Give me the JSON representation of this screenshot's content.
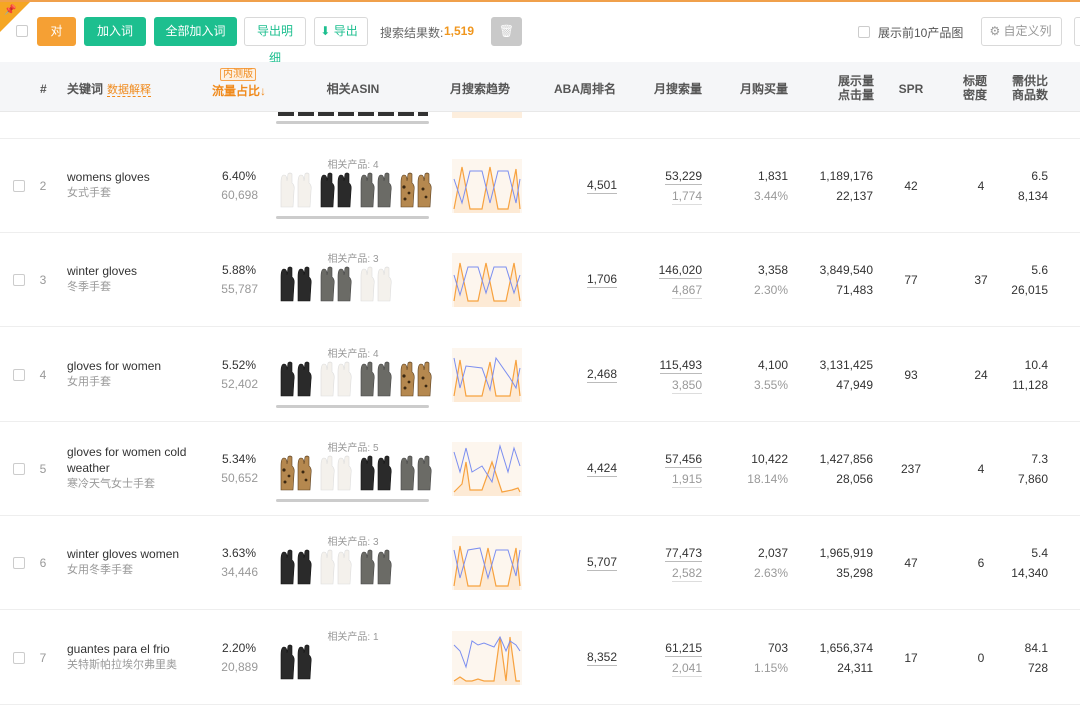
{
  "toolbar": {
    "compare": "对比",
    "add_to_lexicon": "加入词库",
    "add_all": "全部加入词库",
    "export_detail": "导出明细",
    "export": "导出",
    "result_label": "搜索结果数:",
    "result_count": "1,519",
    "show_top10": "展示前10产品图",
    "custom_columns": "自定义列"
  },
  "headers": {
    "index": "#",
    "keyword": "关键词",
    "data_explain": "数据解释",
    "beta": "内测版",
    "flow_share": "流量占比↓",
    "asin": "相关ASIN",
    "trend": "月搜索趋势",
    "aba": "ABA周排名",
    "monthly_search": "月搜索量",
    "monthly_buy": "月购买量",
    "impressions_1": "展示量",
    "impressions_2": "点击量",
    "spr": "SPR",
    "title_1": "标题",
    "title_2": "密度",
    "supply_1": "需供比",
    "supply_2": "商品数"
  },
  "colors": {
    "accent_orange": "#f5a034",
    "accent_green": "#1dbf8f",
    "trend_orange": "#f7a23f",
    "trend_blue": "#7b8ef0"
  },
  "rows": [
    {
      "idx": "2",
      "kw": "womens gloves",
      "kw_cn": "女式手套",
      "pct": "6.40%",
      "pct_n": "60,698",
      "prod_label": "相关产品: 4",
      "aba": "4,501",
      "ms": "53,229",
      "ms2": "1,774",
      "mb": "1,831",
      "mb2": "3.44%",
      "imp": "1,189,176",
      "clk": "22,137",
      "spr": "42",
      "td": "4",
      "ss": "6.5",
      "goods": "8,134",
      "gloves": [
        "white",
        "black",
        "gray",
        "leopard"
      ]
    },
    {
      "idx": "3",
      "kw": "winter gloves",
      "kw_cn": "冬季手套",
      "pct": "5.88%",
      "pct_n": "55,787",
      "prod_label": "相关产品: 3",
      "aba": "1,706",
      "ms": "146,020",
      "ms2": "4,867",
      "mb": "3,358",
      "mb2": "2.30%",
      "imp": "3,849,540",
      "clk": "71,483",
      "spr": "77",
      "td": "37",
      "ss": "5.6",
      "goods": "26,015",
      "gloves": [
        "black",
        "gray",
        "white"
      ]
    },
    {
      "idx": "4",
      "kw": "gloves for women",
      "kw_cn": "女用手套",
      "pct": "5.52%",
      "pct_n": "52,402",
      "prod_label": "相关产品: 4",
      "aba": "2,468",
      "ms": "115,493",
      "ms2": "3,850",
      "mb": "4,100",
      "mb2": "3.55%",
      "imp": "3,131,425",
      "clk": "47,949",
      "spr": "93",
      "td": "24",
      "ss": "10.4",
      "goods": "11,128",
      "gloves": [
        "black",
        "white",
        "gray",
        "leopard"
      ]
    },
    {
      "idx": "5",
      "kw": "gloves for women cold weather",
      "kw_cn": "寒冷天气女士手套",
      "pct": "5.34%",
      "pct_n": "50,652",
      "prod_label": "相关产品: 5",
      "aba": "4,424",
      "ms": "57,456",
      "ms2": "1,915",
      "mb": "10,422",
      "mb2": "18.14%",
      "imp": "1,427,856",
      "clk": "28,056",
      "spr": "237",
      "td": "4",
      "ss": "7.3",
      "goods": "7,860",
      "gloves": [
        "leopard",
        "white",
        "black",
        "gray"
      ]
    },
    {
      "idx": "6",
      "kw": "winter gloves women",
      "kw_cn": "女用冬季手套",
      "pct": "3.63%",
      "pct_n": "34,446",
      "prod_label": "相关产品: 3",
      "aba": "5,707",
      "ms": "77,473",
      "ms2": "2,582",
      "mb": "2,037",
      "mb2": "2.63%",
      "imp": "1,965,919",
      "clk": "35,298",
      "spr": "47",
      "td": "6",
      "ss": "5.4",
      "goods": "14,340",
      "gloves": [
        "black",
        "white",
        "gray"
      ]
    },
    {
      "idx": "7",
      "kw": "guantes para el frio",
      "kw_cn": "关特斯帕拉埃尔弗里奥",
      "pct": "2.20%",
      "pct_n": "20,889",
      "prod_label": "相关产品: 1",
      "aba": "8,352",
      "ms": "61,215",
      "ms2": "2,041",
      "mb": "703",
      "mb2": "1.15%",
      "imp": "1,656,374",
      "clk": "24,311",
      "spr": "17",
      "td": "0",
      "ss": "84.1",
      "goods": "728",
      "gloves": [
        "black"
      ]
    }
  ]
}
